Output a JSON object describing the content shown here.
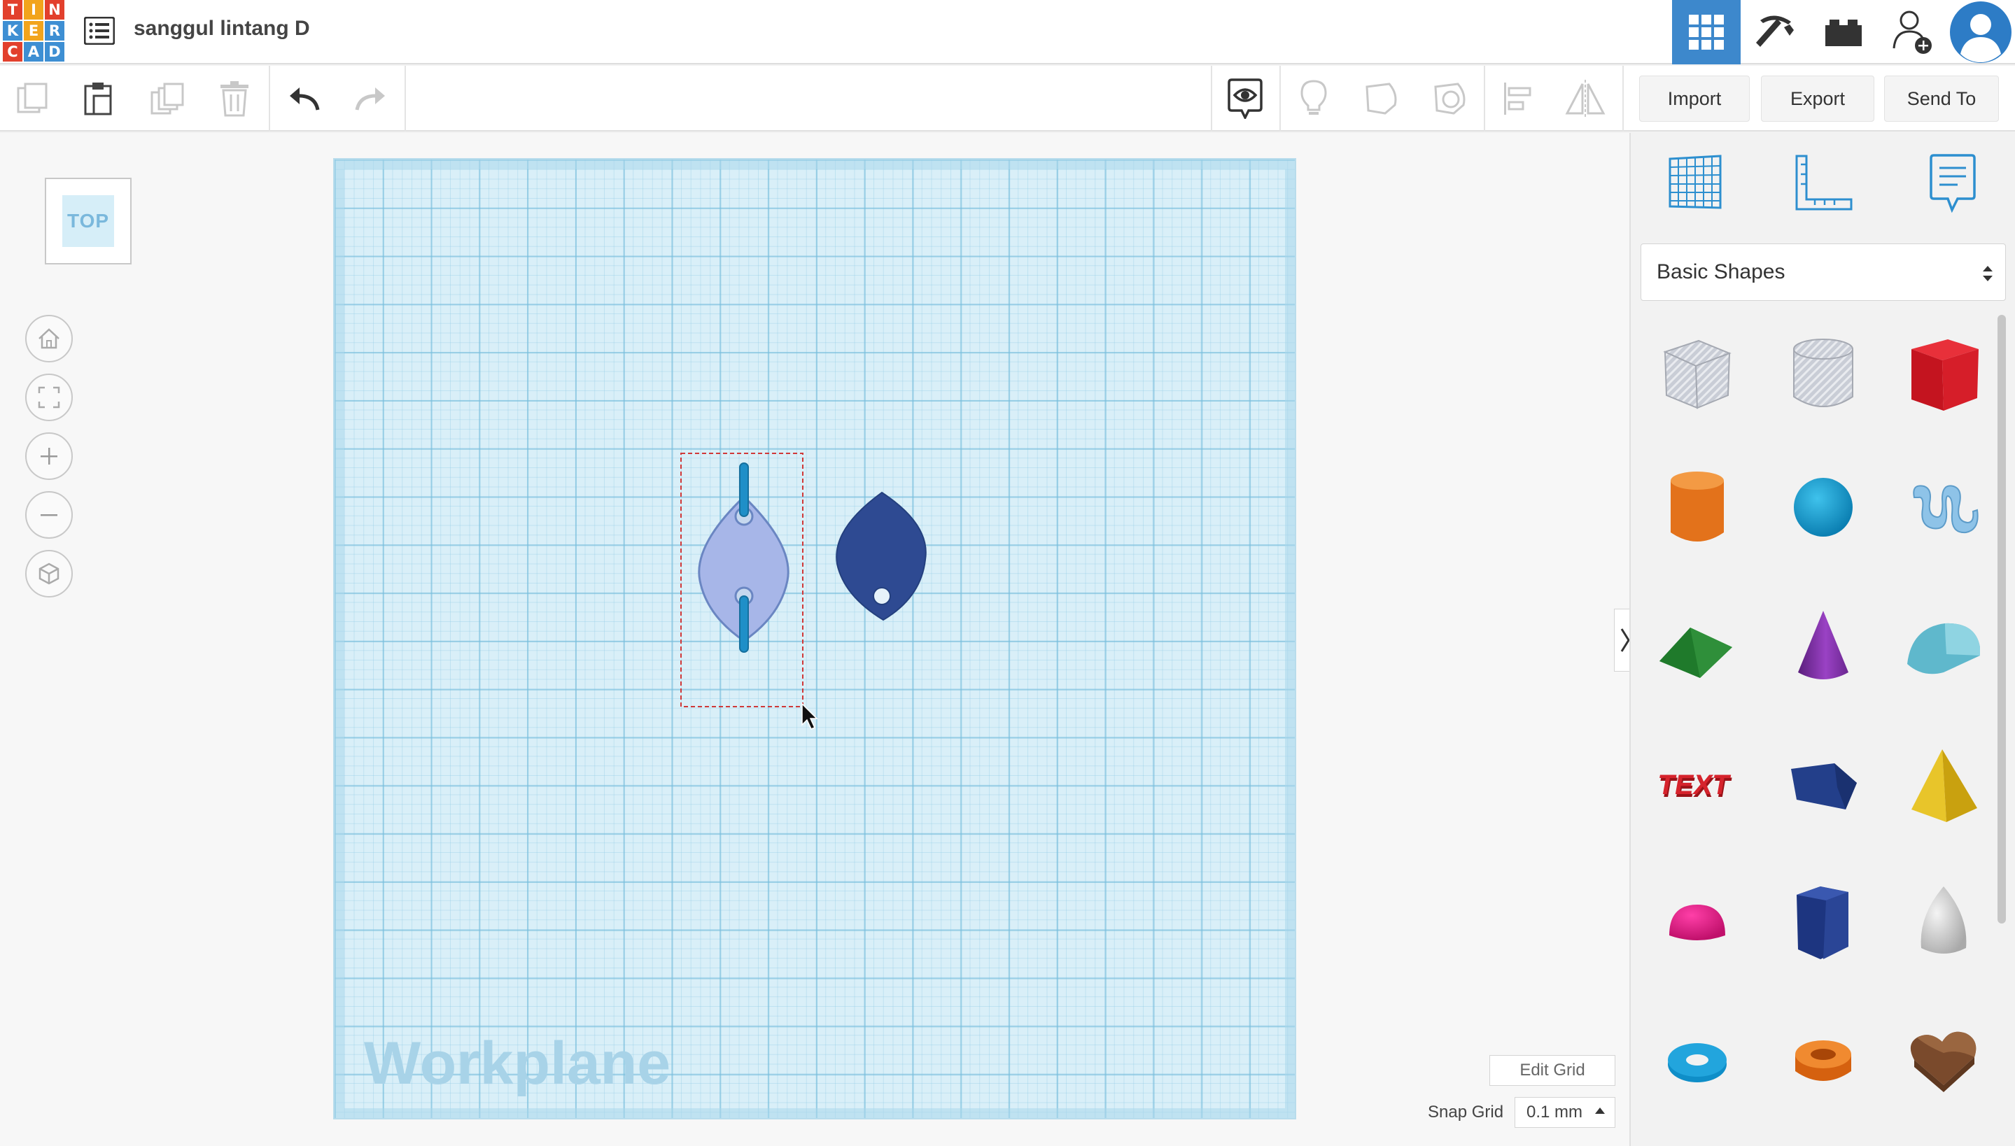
{
  "app": {
    "logo_letters": [
      "T",
      "I",
      "N",
      "K",
      "E",
      "R",
      "C",
      "A",
      "D"
    ],
    "logo_colors": [
      "#e2402d",
      "#f2a41c",
      "#e2402d",
      "#3e8fd3",
      "#f2a41c",
      "#3e8fd3",
      "#e2402d",
      "#3e8fd3",
      "#3e8fd3"
    ],
    "design_title": "sanggul lintang D",
    "accent_color": "#3d88cc"
  },
  "topbar_icons": [
    "design-list-icon",
    "grid-view-icon",
    "pickaxe-icon",
    "bricks-icon",
    "add-user-icon",
    "user-avatar-icon"
  ],
  "toolbar": {
    "tools": [
      "copy-icon",
      "paste-icon",
      "duplicate-icon",
      "delete-icon",
      "undo-icon",
      "redo-icon",
      "notes-toggle-icon",
      "light-bulb-icon",
      "solid-icon",
      "hole-icon",
      "align-icon",
      "mirror-icon"
    ],
    "import_label": "Import",
    "export_label": "Export",
    "send_to_label": "Send To"
  },
  "canvas": {
    "view_cube_label": "TOP",
    "nav_icons": [
      "home-view-icon",
      "fit-view-icon",
      "zoom-in-icon",
      "zoom-out-icon",
      "perspective-icon"
    ],
    "workplane_label": "Workplane",
    "edit_grid_label": "Edit Grid",
    "snap_grid_label": "Snap Grid",
    "snap_grid_value": "0.1 mm",
    "object_colors": {
      "selected_fill": "#a7b6e8",
      "selected_stroke": "#6a86c2",
      "pin": "#1f8fc8",
      "dark_shape": "#2e4a92",
      "selection_box": "#d03838"
    }
  },
  "panel": {
    "tabs": [
      "workplane-grid-icon",
      "ruler-icon",
      "notes-icon"
    ],
    "category_label": "Basic Shapes",
    "shapes": [
      "box-hole",
      "cylinder-hole",
      "box",
      "cylinder",
      "sphere",
      "scribble",
      "roof",
      "cone",
      "round-roof",
      "text",
      "wedge-prism",
      "pyramid",
      "half-sphere",
      "polygon",
      "paraboloid",
      "torus",
      "tube",
      "heart"
    ]
  }
}
